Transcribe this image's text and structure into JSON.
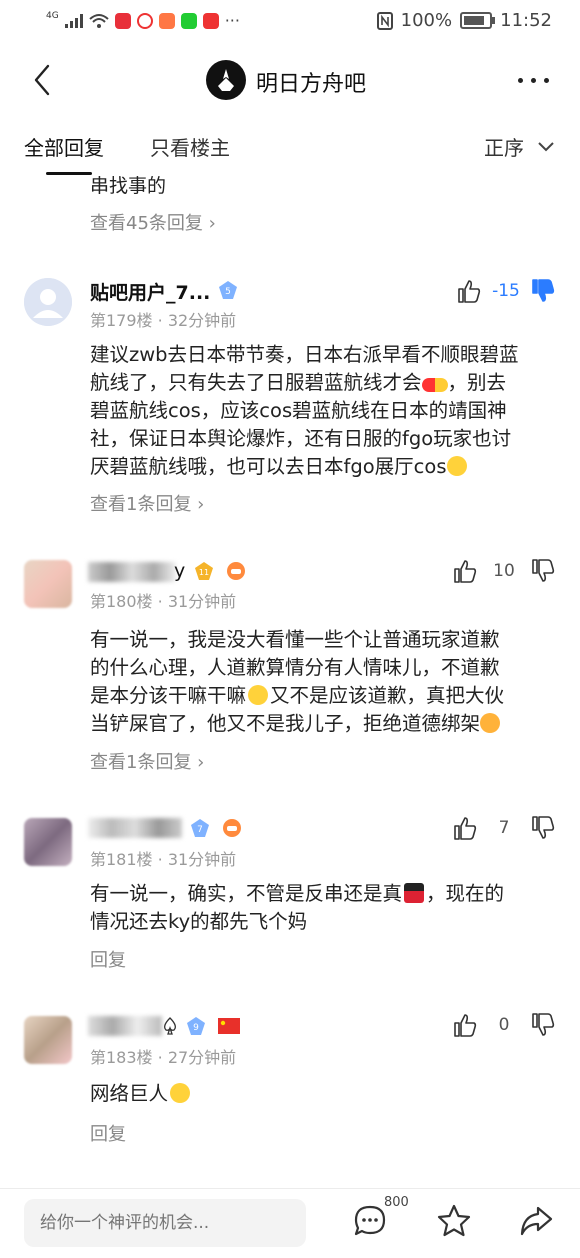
{
  "status_bar": {
    "network": "4G",
    "battery": "100%",
    "time": "11:52"
  },
  "nav": {
    "forum_title": "明日方舟吧"
  },
  "tabs": {
    "all": "全部回复",
    "owner": "只看楼主",
    "sort": "正序"
  },
  "prev_post": {
    "text_tail": "串找事的",
    "view_replies": "查看45条回复"
  },
  "posts": [
    {
      "username": "贴吧用户_7...",
      "level": "5",
      "floor": "第179楼",
      "time": "32分钟前",
      "like_count": "-15",
      "lines": [
        "建议zwb去日本带节奏，日本右派早看不顺眼碧蓝",
        "航线了，只有失去了日服碧蓝航线才会",
        "，别去",
        "碧蓝航线cos，应该cos碧蓝航线在日本的靖国神",
        "社，保证日本舆论爆炸，还有日服的fgo玩家也讨",
        "厌碧蓝航线哦，也可以去日本fgo展厅cos"
      ],
      "view_replies": "查看1条回复"
    },
    {
      "username": "y",
      "level": "11",
      "floor": "第180楼",
      "time": "31分钟前",
      "like_count": "10",
      "lines": [
        "有一说一，我是没大看懂一些个让普通玩家道歉",
        "的什么心理，人道歉算情分有人情味儿，不道歉",
        "是本分该干嘛干嘛",
        "又不是应该道歉，真把大伙",
        "当铲屎官了，他又不是我儿子，拒绝道德绑架"
      ],
      "view_replies": "查看1条回复"
    },
    {
      "username": "",
      "level": "7",
      "floor": "第181楼",
      "time": "31分钟前",
      "like_count": "7",
      "lines": [
        "有一说一，确实，不管是反串还是真",
        "，现在的",
        "情况还去ky的都先飞个妈"
      ],
      "reply": "回复"
    },
    {
      "username": "",
      "level": "9",
      "floor": "第183楼",
      "time": "27分钟前",
      "like_count": "0",
      "lines": [
        "网络巨人"
      ],
      "reply": "回复"
    }
  ],
  "bottom_bar": {
    "placeholder": "给你一个神评的机会...",
    "reply_count": "800"
  },
  "colors": {
    "accent_blue": "#2b7cff",
    "text": "#222222",
    "meta": "#9a9a9a"
  }
}
